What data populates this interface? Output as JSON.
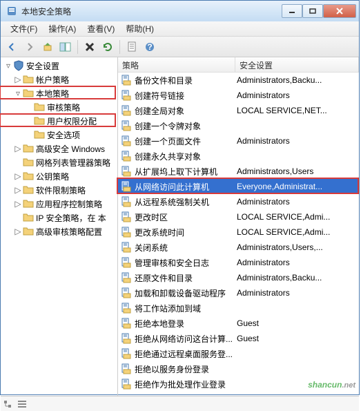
{
  "window": {
    "title": "本地安全策略"
  },
  "menu": {
    "file": "文件(F)",
    "action": "操作(A)",
    "view": "查看(V)",
    "help": "帮助(H)"
  },
  "toolbar_icons": [
    "back",
    "forward",
    "up",
    "tree-toggle",
    "delete",
    "refresh",
    "properties",
    "help"
  ],
  "tree": {
    "root": "安全设置",
    "items": [
      {
        "label": "帐户策略",
        "depth": 1,
        "twist": "▷"
      },
      {
        "label": "本地策略",
        "depth": 1,
        "twist": "▿",
        "hl": true
      },
      {
        "label": "审核策略",
        "depth": 2,
        "twist": ""
      },
      {
        "label": "用户权限分配",
        "depth": 2,
        "twist": "",
        "hl": true
      },
      {
        "label": "安全选项",
        "depth": 2,
        "twist": ""
      },
      {
        "label": "高级安全 Windows",
        "depth": 1,
        "twist": "▷"
      },
      {
        "label": "网格列表管理器策略",
        "depth": 1,
        "twist": ""
      },
      {
        "label": "公钥策略",
        "depth": 1,
        "twist": "▷"
      },
      {
        "label": "软件限制策略",
        "depth": 1,
        "twist": "▷"
      },
      {
        "label": "应用程序控制策略",
        "depth": 1,
        "twist": "▷"
      },
      {
        "label": "IP 安全策略，在 本",
        "depth": 1,
        "twist": ""
      },
      {
        "label": "高级审核策略配置",
        "depth": 1,
        "twist": "▷"
      }
    ]
  },
  "list": {
    "col1": "策略",
    "col2": "安全设置",
    "rows": [
      {
        "p": "备份文件和目录",
        "s": "Administrators,Backu..."
      },
      {
        "p": "创建符号链接",
        "s": "Administrators"
      },
      {
        "p": "创建全局对象",
        "s": "LOCAL SERVICE,NET..."
      },
      {
        "p": "创建一个令牌对象",
        "s": ""
      },
      {
        "p": "创建一个页面文件",
        "s": "Administrators"
      },
      {
        "p": "创建永久共享对象",
        "s": ""
      },
      {
        "p": "从扩展坞上取下计算机",
        "s": "Administrators,Users"
      },
      {
        "p": "从网络访问此计算机",
        "s": "Everyone,Administrat...",
        "sel": true,
        "hl": true
      },
      {
        "p": "从远程系统强制关机",
        "s": "Administrators"
      },
      {
        "p": "更改时区",
        "s": "LOCAL SERVICE,Admi..."
      },
      {
        "p": "更改系统时间",
        "s": "LOCAL SERVICE,Admi..."
      },
      {
        "p": "关闭系统",
        "s": "Administrators,Users,..."
      },
      {
        "p": "管理审核和安全日志",
        "s": "Administrators"
      },
      {
        "p": "还原文件和目录",
        "s": "Administrators,Backu..."
      },
      {
        "p": "加载和卸载设备驱动程序",
        "s": "Administrators"
      },
      {
        "p": "将工作站添加到域",
        "s": ""
      },
      {
        "p": "拒绝本地登录",
        "s": "Guest"
      },
      {
        "p": "拒绝从网络访问这台计算...",
        "s": "Guest"
      },
      {
        "p": "拒绝通过远程桌面服务登...",
        "s": ""
      },
      {
        "p": "拒绝以服务身份登录",
        "s": ""
      },
      {
        "p": "拒绝作为批处理作业登录",
        "s": ""
      }
    ]
  },
  "watermark": {
    "main": "shancun",
    "suffix": ".net"
  }
}
